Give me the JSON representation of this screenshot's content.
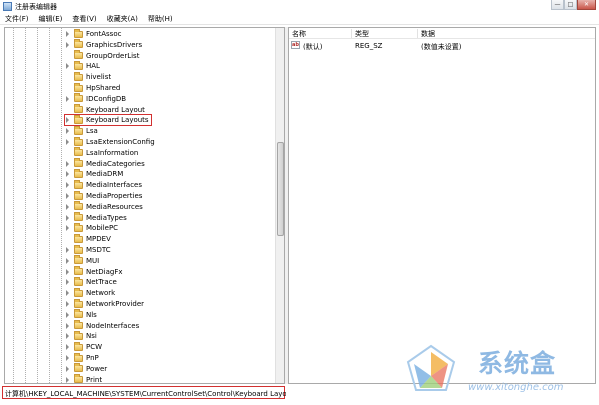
{
  "window": {
    "title": "注册表编辑器",
    "buttons": {
      "minimize": "—",
      "maximize": "□",
      "close": "✕"
    }
  },
  "menu": [
    "文件(F)",
    "编辑(E)",
    "查看(V)",
    "收藏夹(A)",
    "帮助(H)"
  ],
  "tree": {
    "items": [
      {
        "label": "FontAssoc",
        "expandable": true
      },
      {
        "label": "GraphicsDrivers",
        "expandable": true
      },
      {
        "label": "GroupOrderList",
        "expandable": false
      },
      {
        "label": "HAL",
        "expandable": true
      },
      {
        "label": "hivelist",
        "expandable": false
      },
      {
        "label": "HpShared",
        "expandable": false
      },
      {
        "label": "IDConfigDB",
        "expandable": true
      },
      {
        "label": "Keyboard Layout",
        "expandable": false
      },
      {
        "label": "Keyboard Layouts",
        "expandable": true,
        "selected": true
      },
      {
        "label": "Lsa",
        "expandable": true
      },
      {
        "label": "LsaExtensionConfig",
        "expandable": true
      },
      {
        "label": "LsaInformation",
        "expandable": false
      },
      {
        "label": "MediaCategories",
        "expandable": true
      },
      {
        "label": "MediaDRM",
        "expandable": true
      },
      {
        "label": "MediaInterfaces",
        "expandable": true
      },
      {
        "label": "MediaProperties",
        "expandable": true
      },
      {
        "label": "MediaResources",
        "expandable": true
      },
      {
        "label": "MediaTypes",
        "expandable": true
      },
      {
        "label": "MobilePC",
        "expandable": true
      },
      {
        "label": "MPDEV",
        "expandable": false
      },
      {
        "label": "MSDTC",
        "expandable": true
      },
      {
        "label": "MUI",
        "expandable": true
      },
      {
        "label": "NetDiagFx",
        "expandable": true
      },
      {
        "label": "NetTrace",
        "expandable": true
      },
      {
        "label": "Network",
        "expandable": true
      },
      {
        "label": "NetworkProvider",
        "expandable": true
      },
      {
        "label": "Nls",
        "expandable": true
      },
      {
        "label": "NodeInterfaces",
        "expandable": true
      },
      {
        "label": "Nsi",
        "expandable": true
      },
      {
        "label": "PCW",
        "expandable": true
      },
      {
        "label": "PnP",
        "expandable": true
      },
      {
        "label": "Power",
        "expandable": true
      },
      {
        "label": "Print",
        "expandable": true
      }
    ]
  },
  "list": {
    "columns": [
      "名称",
      "类型",
      "数据"
    ],
    "rows": [
      {
        "icon": "ab",
        "name": "(默认)",
        "type": "REG_SZ",
        "data": "(数值未设置)"
      }
    ]
  },
  "status": {
    "path": "计算机\\HKEY_LOCAL_MACHINE\\SYSTEM\\CurrentControlSet\\Control\\Keyboard Layouts"
  },
  "watermark": {
    "name": "系统盒",
    "url": "www.xitonghe.com"
  },
  "colors": {
    "highlight_box": "#d23030",
    "folder": "#e8bd4c",
    "watermark_text": "#8fb9e3"
  },
  "icons": {
    "app": "registry-editor-icon",
    "folder": "folder-icon",
    "expander": "chevron-right-icon",
    "value": "string-value-icon"
  }
}
